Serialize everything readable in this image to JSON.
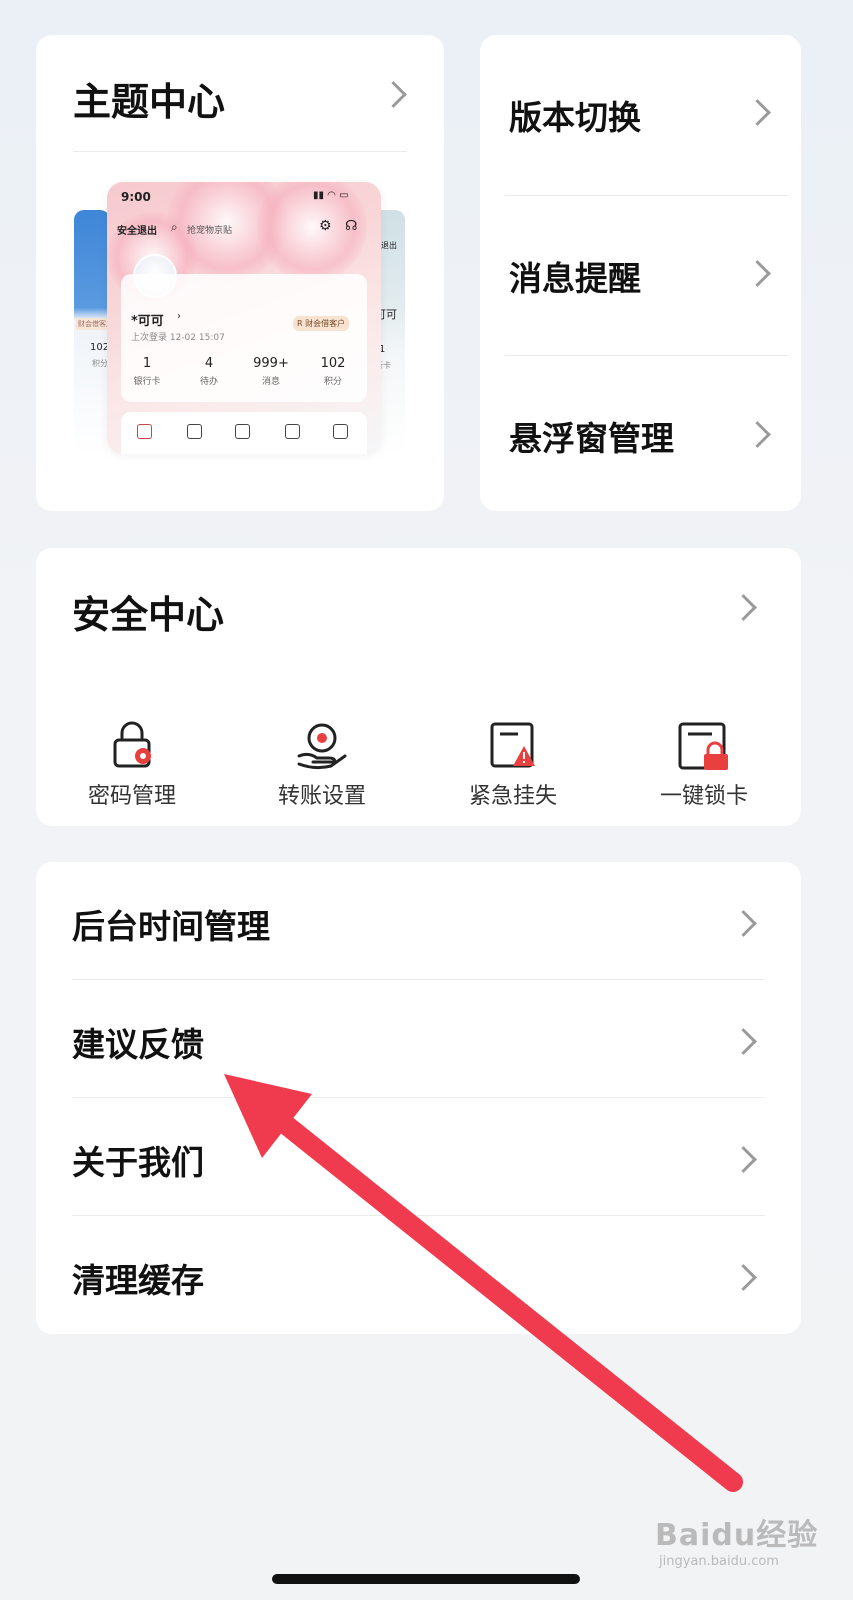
{
  "theme_center": {
    "title": "主题中心",
    "preview": {
      "time": "9:00",
      "logout": "安全退出",
      "search": "抢宠物京贴",
      "username": "*可可",
      "last_login": "上次登录 12-02 15:07",
      "member_badge": "R 财会借客户",
      "stats": [
        {
          "value": "1",
          "label": "银行卡"
        },
        {
          "value": "4",
          "label": "待办"
        },
        {
          "value": "999+",
          "label": "消息"
        },
        {
          "value": "102",
          "label": "积分"
        }
      ],
      "left_side": {
        "badge": "财会借客户",
        "value": "102",
        "label": "积分"
      },
      "right_side": {
        "logout": "出退出",
        "username": "可可",
        "value": "1",
        "label": "行卡"
      }
    }
  },
  "right_menu": [
    {
      "label": "版本切换"
    },
    {
      "label": "消息提醒"
    },
    {
      "label": "悬浮窗管理"
    }
  ],
  "security_center": {
    "title": "安全中心",
    "items": [
      {
        "label": "密码管理",
        "icon": "lock-icon"
      },
      {
        "label": "转账设置",
        "icon": "hand-coin-icon"
      },
      {
        "label": "紧急挂失",
        "icon": "card-warning-icon"
      },
      {
        "label": "一键锁卡",
        "icon": "card-lock-icon"
      }
    ]
  },
  "settings_list": [
    {
      "label": "后台时间管理"
    },
    {
      "label": "建议反馈"
    },
    {
      "label": "关于我们"
    },
    {
      "label": "清理缓存"
    }
  ],
  "watermark": {
    "brand": "Baidu经验",
    "url": "jingyan.baidu.com"
  },
  "colors": {
    "accent_red": "#f03a4e",
    "icon_red": "#e8403f"
  }
}
